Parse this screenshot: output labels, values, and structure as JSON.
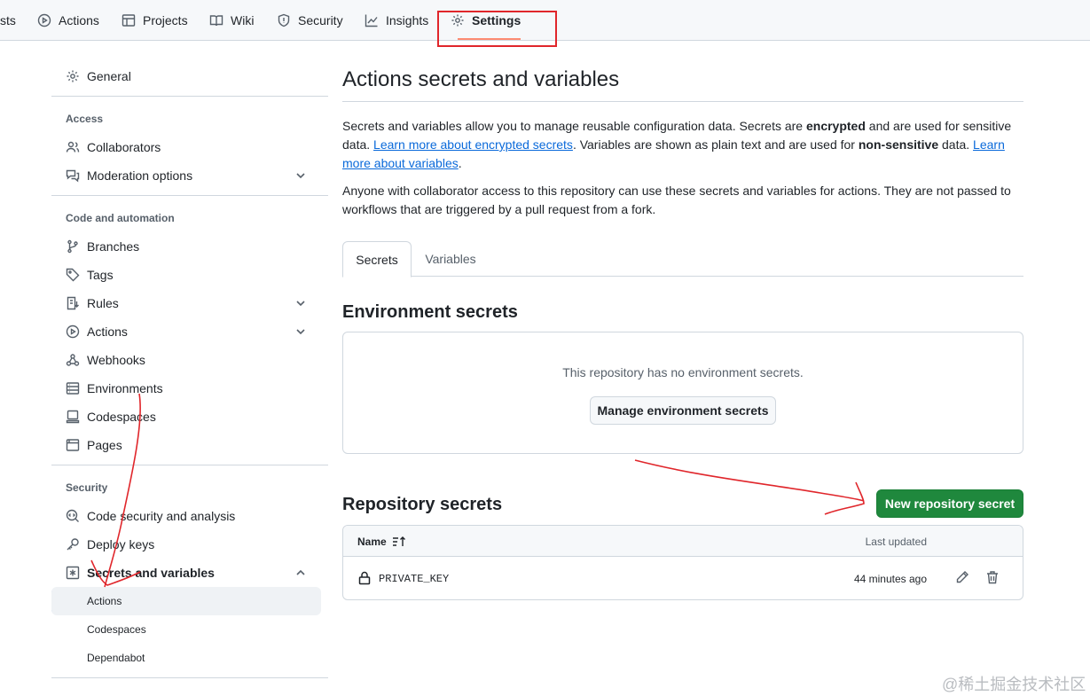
{
  "topnav": {
    "items": [
      {
        "label": "sts",
        "icon": "pull-request-icon"
      },
      {
        "label": "Actions",
        "icon": "play-icon"
      },
      {
        "label": "Projects",
        "icon": "table-icon"
      },
      {
        "label": "Wiki",
        "icon": "book-icon"
      },
      {
        "label": "Security",
        "icon": "shield-icon"
      },
      {
        "label": "Insights",
        "icon": "graph-icon"
      },
      {
        "label": "Settings",
        "icon": "gear-icon"
      }
    ]
  },
  "sidebar": {
    "general": "General",
    "access_heading": "Access",
    "collaborators": "Collaborators",
    "moderation": "Moderation options",
    "code_heading": "Code and automation",
    "branches": "Branches",
    "tags": "Tags",
    "rules": "Rules",
    "actions": "Actions",
    "webhooks": "Webhooks",
    "environments": "Environments",
    "codespaces": "Codespaces",
    "pages": "Pages",
    "security_heading": "Security",
    "code_security": "Code security and analysis",
    "deploy_keys": "Deploy keys",
    "secrets_vars": "Secrets and variables",
    "sub_actions": "Actions",
    "sub_codespaces": "Codespaces",
    "sub_dependabot": "Dependabot"
  },
  "main": {
    "title": "Actions secrets and variables",
    "p1": {
      "t1": "Secrets and variables allow you to manage reusable configuration data. Secrets are ",
      "b1": "encrypted",
      "t2": " and are used for sensitive data. ",
      "link1": "Learn more about encrypted secrets",
      "t3": ". Variables are shown as plain text and are used for ",
      "b2": "non-sensitive",
      "t4": " data. ",
      "link2": "Learn more about variables",
      "t5": "."
    },
    "p2": "Anyone with collaborator access to this repository can use these secrets and variables for actions. They are not passed to workflows that are triggered by a pull request from a fork.",
    "tabs": [
      "Secrets",
      "Variables"
    ],
    "env_heading": "Environment secrets",
    "env_empty": "This repository has no environment secrets.",
    "manage_button": "Manage environment secrets",
    "repo_heading": "Repository secrets",
    "new_button": "New repository secret",
    "table": {
      "col_name": "Name",
      "col_updated": "Last updated",
      "rows": [
        {
          "name": "PRIVATE_KEY",
          "updated": "44 minutes ago"
        }
      ]
    }
  },
  "colors": {
    "accent": "#0969da",
    "primary_button": "#1f883d",
    "annotation": "#e0262b"
  },
  "watermark": "@稀土掘金技术社区"
}
